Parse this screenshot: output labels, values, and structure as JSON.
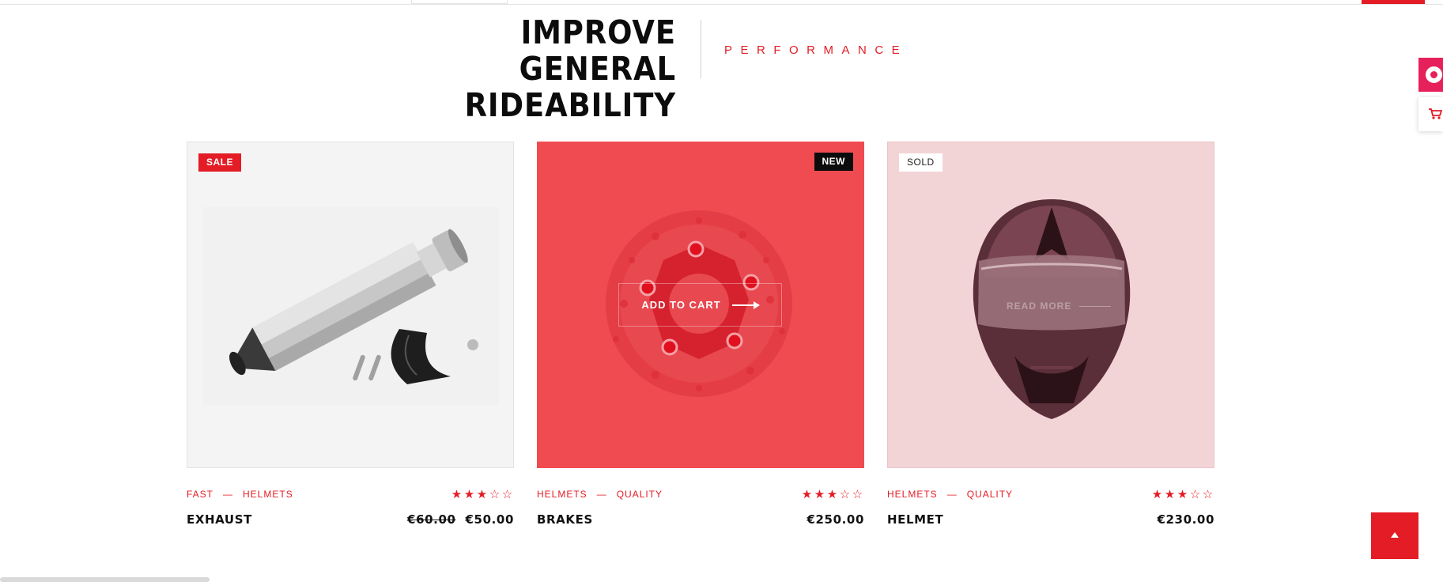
{
  "section": {
    "title_line1": "IMPROVE GENERAL",
    "title_line2": "RIDEABILITY",
    "subtitle": "PERFORMANCE"
  },
  "colors": {
    "accent": "#e31c25",
    "chat": "#e6205a",
    "card2_bg": "#f04b51",
    "card3_bg": "#f3d4d6"
  },
  "side_widgets": {
    "chat_icon": "chat-bubble-icon",
    "cart_icon": "cart-icon"
  },
  "products": [
    {
      "badge": "SALE",
      "category1": "FAST",
      "separator": "—",
      "category2": "HELMETS",
      "rating": 3,
      "rating_max": 5,
      "name": "EXHAUST",
      "old_price": "€60.00",
      "price": "€50.00",
      "image": "exhaust-muffler"
    },
    {
      "badge": "NEW",
      "category1": "HELMETS",
      "separator": "—",
      "category2": "QUALITY",
      "rating": 3,
      "rating_max": 5,
      "name": "BRAKES",
      "price": "€250.00",
      "image": "brake-disc",
      "hover_action": "ADD TO CART"
    },
    {
      "badge": "SOLD",
      "category1": "HELMETS",
      "separator": "—",
      "category2": "QUALITY",
      "rating": 3,
      "rating_max": 5,
      "name": "HELMET",
      "price": "€230.00",
      "image": "motorcycle-helmet",
      "hover_action": "READ MORE"
    }
  ],
  "back_to_top_icon": "arrow-up-icon"
}
